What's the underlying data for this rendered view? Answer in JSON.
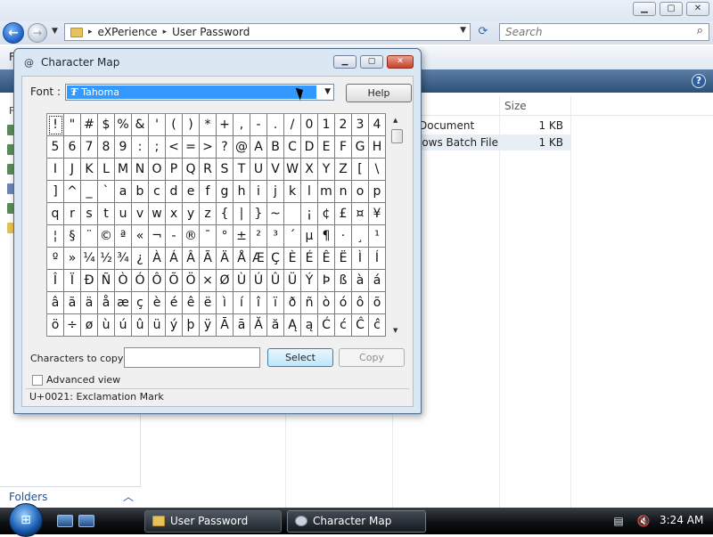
{
  "explorer": {
    "breadcrumb": [
      "eXPerience",
      "User Password"
    ],
    "search_placeholder": "Search",
    "toolbar_fragment": "F",
    "left_pane_fragment": "F",
    "columns": {
      "size": "Size"
    },
    "files": [
      {
        "name": "Document",
        "size": "1 KB"
      },
      {
        "name": "lows Batch File",
        "size": "1 KB"
      }
    ],
    "folders_label": "Folders"
  },
  "charmap": {
    "title": "Character Map",
    "font_label": "Font :",
    "font_value": "Tahoma",
    "help_label": "Help",
    "characters": [
      "!",
      "\"",
      "#",
      "$",
      "%",
      "&",
      "'",
      "(",
      ")",
      "*",
      "+",
      ",",
      "-",
      ".",
      "/",
      "0",
      "1",
      "2",
      "3",
      "4",
      "5",
      "6",
      "7",
      "8",
      "9",
      ":",
      ";",
      "<",
      "=",
      ">",
      "?",
      "@",
      "A",
      "B",
      "C",
      "D",
      "E",
      "F",
      "G",
      "H",
      "I",
      "J",
      "K",
      "L",
      "M",
      "N",
      "O",
      "P",
      "Q",
      "R",
      "S",
      "T",
      "U",
      "V",
      "W",
      "X",
      "Y",
      "Z",
      "[",
      "\\",
      "]",
      "^",
      "_",
      "`",
      "a",
      "b",
      "c",
      "d",
      "e",
      "f",
      "g",
      "h",
      "i",
      "j",
      "k",
      "l",
      "m",
      "n",
      "o",
      "p",
      "q",
      "r",
      "s",
      "t",
      "u",
      "v",
      "w",
      "x",
      "y",
      "z",
      "{",
      "|",
      "}",
      "~",
      " ",
      "¡",
      "¢",
      "£",
      "¤",
      "¥",
      "¦",
      "§",
      "¨",
      "©",
      "ª",
      "«",
      "¬",
      "-",
      "®",
      "¯",
      "°",
      "±",
      "²",
      "³",
      "´",
      "µ",
      "¶",
      "·",
      "¸",
      "¹",
      "º",
      "»",
      "¼",
      "½",
      "¾",
      "¿",
      "À",
      "Á",
      "Â",
      "Ã",
      "Ä",
      "Å",
      "Æ",
      "Ç",
      "È",
      "É",
      "Ê",
      "Ë",
      "Ì",
      "Í",
      "Î",
      "Ï",
      "Ð",
      "Ñ",
      "Ò",
      "Ó",
      "Ô",
      "Õ",
      "Ö",
      "×",
      "Ø",
      "Ù",
      "Ú",
      "Û",
      "Ü",
      "Ý",
      "Þ",
      "ß",
      "à",
      "á",
      "â",
      "ã",
      "ä",
      "å",
      "æ",
      "ç",
      "è",
      "é",
      "ê",
      "ë",
      "ì",
      "í",
      "î",
      "ï",
      "ð",
      "ñ",
      "ò",
      "ó",
      "ô",
      "õ",
      "ö",
      "÷",
      "ø",
      "ù",
      "ú",
      "û",
      "ü",
      "ý",
      "þ",
      "ÿ",
      "Ā",
      "ā",
      "Ă",
      "ă",
      "Ą",
      "ą",
      "Ć",
      "ć",
      "Ĉ",
      "ĉ"
    ],
    "selected_index": 0,
    "characters_to_copy_label": "Characters to copy :",
    "characters_to_copy_value": "",
    "select_label": "Select",
    "copy_label": "Copy",
    "advanced_view_label": "Advanced view",
    "advanced_view_checked": false,
    "status_text": "U+0021: Exclamation Mark"
  },
  "taskbar": {
    "buttons": [
      {
        "label": "User Password",
        "active": false
      },
      {
        "label": "Character Map",
        "active": true
      }
    ],
    "clock": "3:24 AM"
  }
}
